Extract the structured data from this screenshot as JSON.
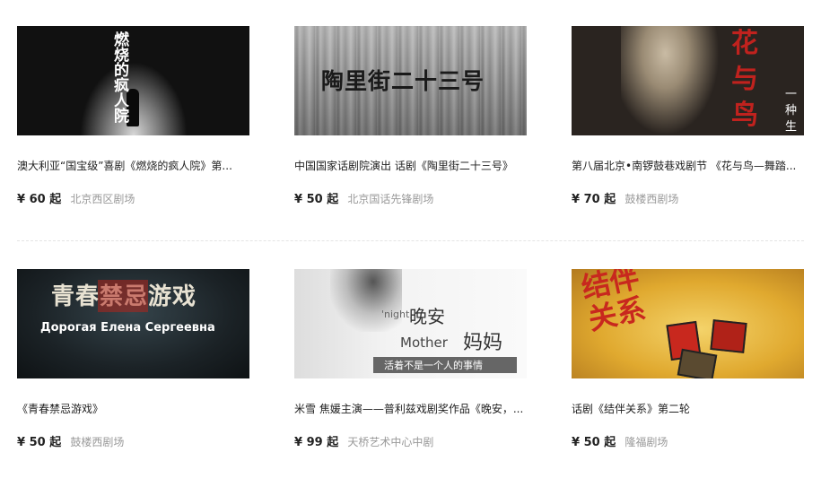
{
  "shows": [
    {
      "title": "澳大利亚“国宝级”喜剧《燃烧的疯人院》第...",
      "price": "¥ 60 起",
      "venue": "北京西区剧场",
      "poster": {
        "text": "燃烧的疯人院",
        "bg": "#111111",
        "accent": "#ffffff"
      }
    },
    {
      "title": "中国国家话剧院演出 话剧《陶里街二十三号》",
      "price": "¥ 50 起",
      "venue": "北京国话先锋剧场",
      "poster": {
        "text": "陶里街二十三号",
        "bg": "#8a8a8a",
        "accent": "#1a1a1a"
      }
    },
    {
      "title": "第八届北京•南锣鼓巷戏剧节 《花与鸟—舞踏...",
      "price": "¥ 70 起",
      "venue": "鼓楼西剧场",
      "poster": {
        "text": "花与鸟",
        "side_text": "一种生",
        "bg": "#2a2420",
        "accent": "#c0221e"
      }
    },
    {
      "title": "《青春禁忌游戏》",
      "price": "¥ 50 起",
      "venue": "鼓楼西剧场",
      "poster": {
        "text": "青春禁忌游戏",
        "sub": "Дорогая Елена Сергеевна",
        "bg": "#1b2226",
        "accent": "#b1241c"
      }
    },
    {
      "title": "米雪 焦媛主演——普利兹戏剧奖作品《晚安，...",
      "price": "¥ 99 起",
      "venue": "天桥艺术中心中剧",
      "poster": {
        "text": "晚安",
        "text2": "妈妈",
        "en1": "'night,",
        "en2": "Mother",
        "sub": "活着不是一个人的事情",
        "bg": "#e8e8e8",
        "accent": "#333333"
      }
    },
    {
      "title": "话剧《结伴关系》第二轮",
      "price": "¥ 50 起",
      "venue": "隆福剧场",
      "poster": {
        "text": "结伴关系",
        "bg": "#e8b73a",
        "accent": "#c8281e"
      }
    }
  ]
}
